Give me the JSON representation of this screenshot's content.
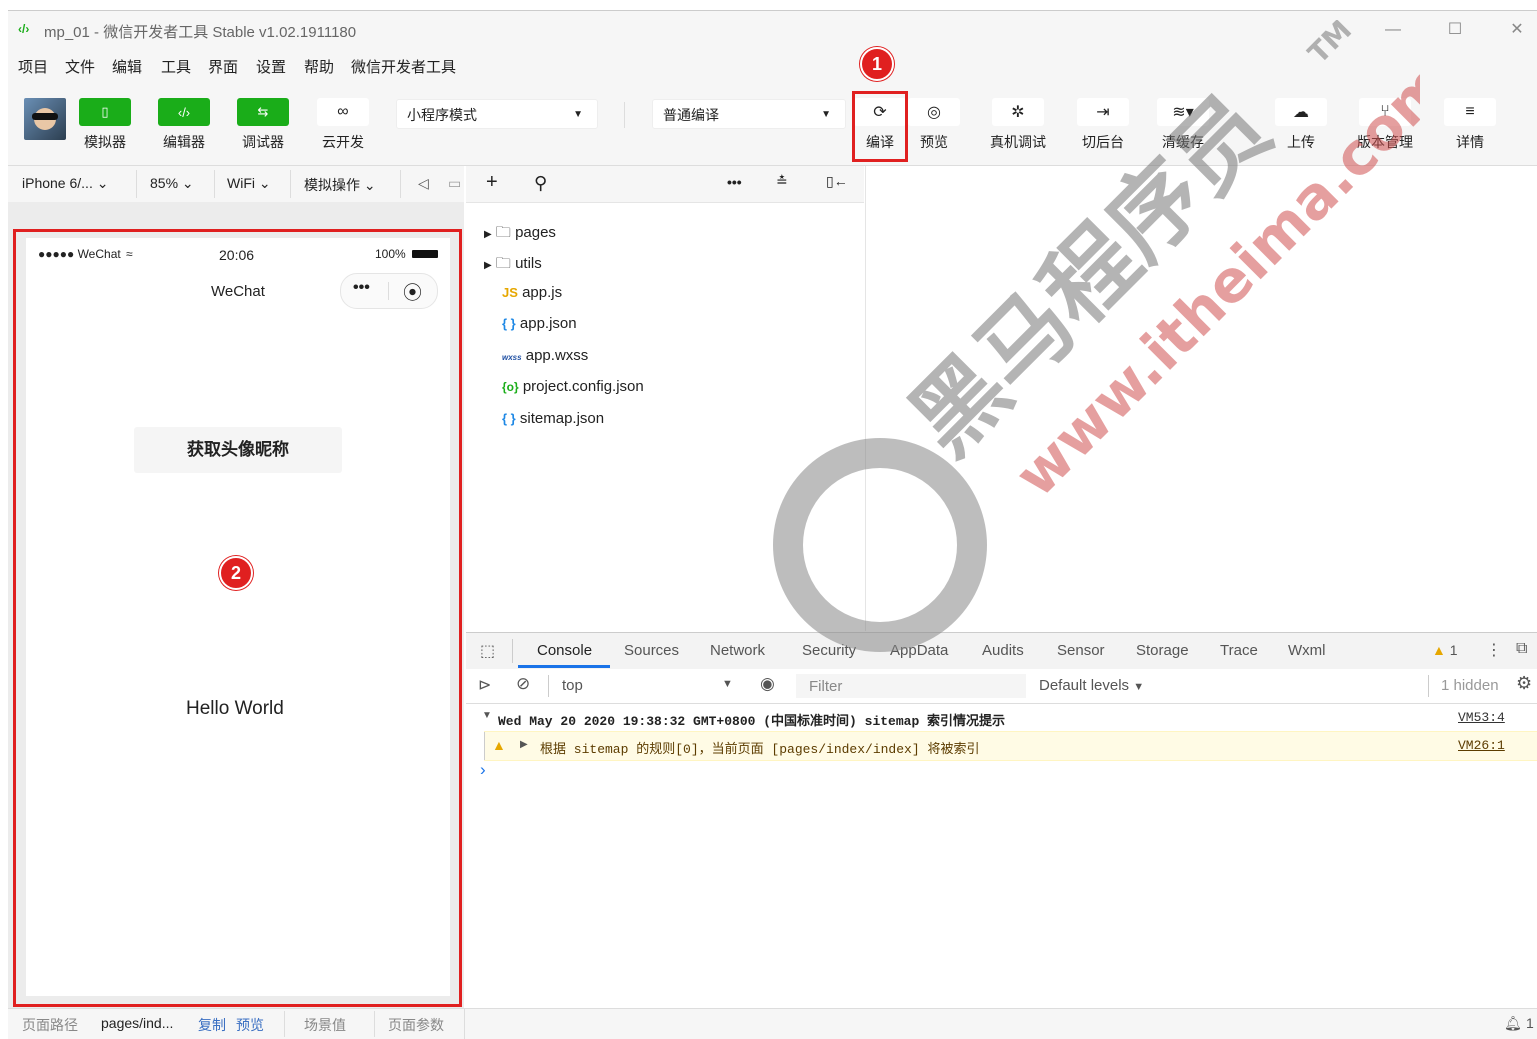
{
  "window": {
    "title": "mp_01 - 微信开发者工具 Stable v1.02.1911180"
  },
  "menu": [
    "项目",
    "文件",
    "编辑",
    "工具",
    "界面",
    "设置",
    "帮助",
    "微信开发者工具"
  ],
  "toolbar": {
    "simulator": "模拟器",
    "editor": "编辑器",
    "debugger": "调试器",
    "cloud": "云开发",
    "mode_select": "小程序模式",
    "compile_select": "普通编译",
    "compile": "编译",
    "preview": "预览",
    "real_debug": "真机调试",
    "background": "切后台",
    "clear_cache": "清缓存",
    "upload": "上传",
    "version": "版本管理",
    "details": "详情"
  },
  "device_bar": {
    "device": "iPhone 6/...",
    "zoom": "85%",
    "network": "WiFi",
    "operation": "模拟操作"
  },
  "phone": {
    "carrier": "●●●●● WeChat",
    "time": "20:06",
    "battery": "100%",
    "nav_title": "WeChat",
    "button_label": "获取头像昵称",
    "hello": "Hello World"
  },
  "files": [
    {
      "icon": "folder",
      "name": "pages",
      "badge": ""
    },
    {
      "icon": "folder",
      "name": "utils",
      "badge": ""
    },
    {
      "icon": "js",
      "name": "app.js",
      "badge": "JS"
    },
    {
      "icon": "json",
      "name": "app.json",
      "badge": "{ }"
    },
    {
      "icon": "wxss",
      "name": "app.wxss",
      "badge": "wxss"
    },
    {
      "icon": "config",
      "name": "project.config.json",
      "badge": "{o}"
    },
    {
      "icon": "json",
      "name": "sitemap.json",
      "badge": "{ }"
    }
  ],
  "devtools": {
    "tabs": [
      "Console",
      "Sources",
      "Network",
      "Security",
      "AppData",
      "Audits",
      "Sensor",
      "Storage",
      "Trace",
      "Wxml"
    ],
    "active_tab": "Console",
    "warning_count": "1",
    "context": "top",
    "filter_placeholder": "Filter",
    "levels": "Default levels",
    "hidden": "1 hidden",
    "log": [
      {
        "text": "Wed May 20 2020 19:38:32 GMT+0800 (中国标准时间) sitemap 索引情况提示",
        "source": "VM53:4"
      },
      {
        "text": "根据 sitemap 的规则[0]，当前页面 [pages/index/index] 将被索引",
        "source": "VM26:1"
      }
    ],
    "prompt": "›"
  },
  "status": {
    "path_label": "页面路径",
    "path": "pages/ind...",
    "copy": "复制",
    "preview": "预览",
    "scene": "场景值",
    "params": "页面参数",
    "notify_count": "1"
  },
  "annotations": {
    "one": "1",
    "two": "2"
  },
  "watermark": {
    "cn": "黑马程序员",
    "url": "www.itheima.com",
    "tm": "TM"
  },
  "colors": {
    "accent_green": "#1aad19",
    "annotation_red": "#e02020",
    "warning_bg": "#fffbe5"
  }
}
